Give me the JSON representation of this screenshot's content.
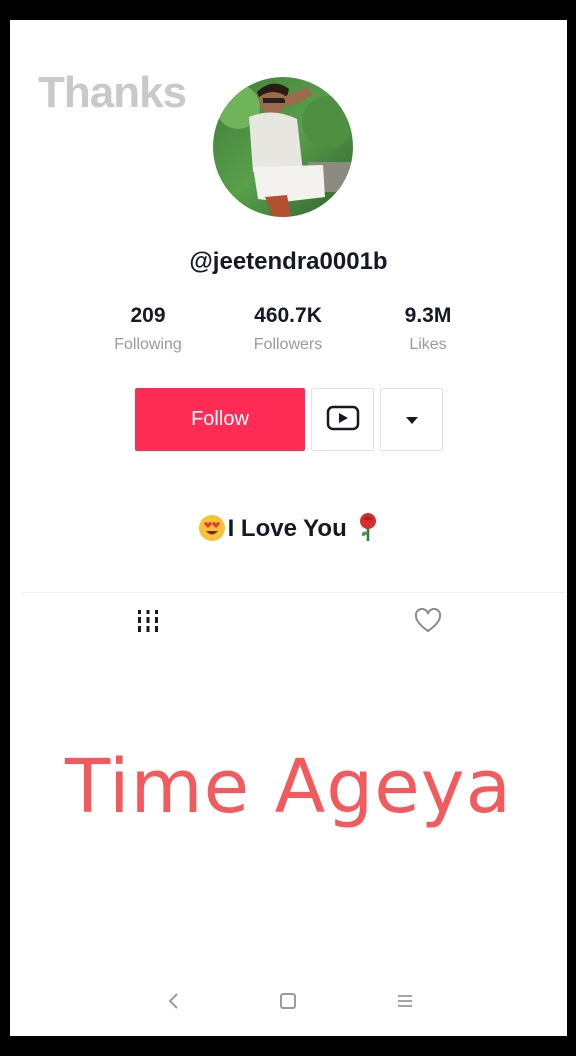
{
  "watermark": {
    "text": "Thanks"
  },
  "profile": {
    "handle": "@jeetendra0001b",
    "stats": [
      {
        "value": "209",
        "label": "Following"
      },
      {
        "value": "460.7K",
        "label": "Followers"
      },
      {
        "value": "9.3M",
        "label": "Likes"
      }
    ],
    "follow_label": "Follow",
    "bio": "I Love You",
    "icons": {
      "video": "youtube-play-icon",
      "more": "dropdown-triangle-icon",
      "emoji": "heart-eyes-emoji",
      "flower": "rose-emoji"
    }
  },
  "tabs": [
    {
      "icon": "videos-grid-icon"
    },
    {
      "icon": "liked-heart-icon"
    }
  ],
  "overlay": {
    "text": "Time Ageya"
  },
  "system_nav": {
    "back": "back-icon",
    "home": "home-icon",
    "menu": "menu-icon"
  },
  "colors": {
    "follow": "#fe2c55",
    "overlay_text": "#f25a5e",
    "text": "#161823",
    "muted": "#9a9aa0"
  }
}
